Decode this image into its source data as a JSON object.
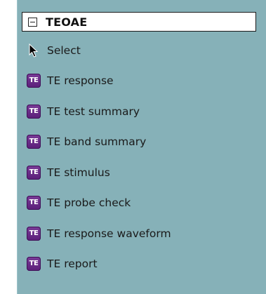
{
  "panel": {
    "title": "TEOAE",
    "collapse_icon": "minus-box-icon",
    "select_item": {
      "label": "Select",
      "icon": "arrow-cursor-icon"
    },
    "items": [
      {
        "label": "TE response",
        "icon_text": "TE"
      },
      {
        "label": "TE test summary",
        "icon_text": "TE"
      },
      {
        "label": "TE band summary",
        "icon_text": "TE"
      },
      {
        "label": "TE stimulus",
        "icon_text": "TE"
      },
      {
        "label": "TE probe check",
        "icon_text": "TE"
      },
      {
        "label": "TE response waveform",
        "icon_text": "TE"
      },
      {
        "label": "TE report",
        "icon_text": "TE"
      }
    ]
  },
  "colors": {
    "panel_background": "#86b1b8",
    "icon_purple": "#6a2c8a"
  }
}
